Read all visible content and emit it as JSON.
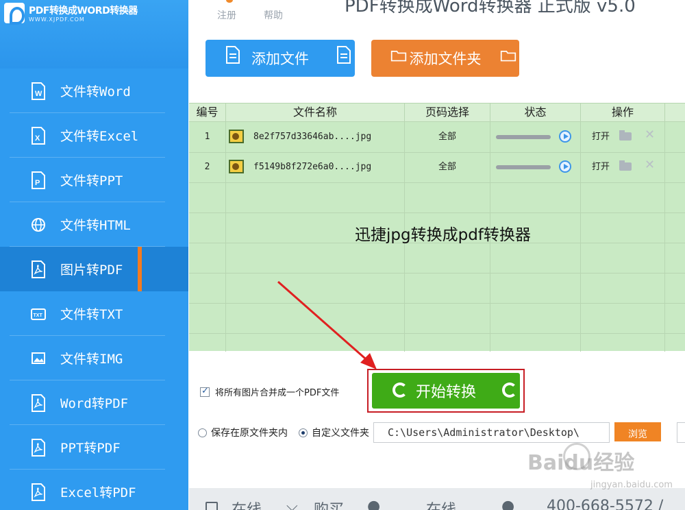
{
  "app": {
    "logo_title": "PDF转换成WORD转换器",
    "logo_url": "WWW.XJPDF.COM",
    "window_title": "PDF转换成Word转换器 正式版 v5.0"
  },
  "menu": {
    "register": "注册",
    "help": "帮助"
  },
  "sidebar": {
    "items": [
      {
        "label": "文件转Word",
        "icon": "word-file-icon"
      },
      {
        "label": "文件转Excel",
        "icon": "excel-file-icon"
      },
      {
        "label": "文件转PPT",
        "icon": "ppt-file-icon"
      },
      {
        "label": "文件转HTML",
        "icon": "globe-icon"
      },
      {
        "label": "图片转PDF",
        "icon": "pdf-file-icon",
        "active": true
      },
      {
        "label": "文件转TXT",
        "icon": "txt-file-icon"
      },
      {
        "label": "文件转IMG",
        "icon": "image-icon"
      },
      {
        "label": "Word转PDF",
        "icon": "pdf-file-icon"
      },
      {
        "label": "PPT转PDF",
        "icon": "pdf-file-icon"
      },
      {
        "label": "Excel转PDF",
        "icon": "pdf-file-icon"
      }
    ]
  },
  "toolbar": {
    "add_file": "添加文件",
    "add_folder": "添加文件夹"
  },
  "table": {
    "headers": [
      "编号",
      "文件名称",
      "页码选择",
      "状态",
      "操作"
    ],
    "rows": [
      {
        "index": "1",
        "filename": "8e2f757d33646ab....jpg",
        "pages": "全部",
        "progress": 0,
        "open": "打开"
      },
      {
        "index": "2",
        "filename": "f5149b8f272e6a0....jpg",
        "pages": "全部",
        "progress": 0,
        "open": "打开"
      }
    ],
    "overlay_text": "迅捷jpg转换成pdf转换器"
  },
  "options": {
    "merge_label": "将所有图片合并成一个PDF文件",
    "merge_checked": true,
    "save_original": "保存在原文件夹内",
    "save_custom": "自定义文件夹",
    "output_path": "C:\\Users\\Administrator\\Desktop\\",
    "browse": "浏览"
  },
  "start_button": "开始转换",
  "footer": {
    "online": "在线",
    "buy": "购买",
    "online2": "在线",
    "phone": "400-668-5572 /"
  },
  "watermark": {
    "brand": "Baidu经验",
    "url": "jingyan.baidu.com"
  },
  "colors": {
    "sidebar": "#2f9bf0",
    "active": "#1e82d6",
    "accent_orange": "#f47b20",
    "start_green": "#3fab17",
    "table_bg": "#c9eac4"
  }
}
